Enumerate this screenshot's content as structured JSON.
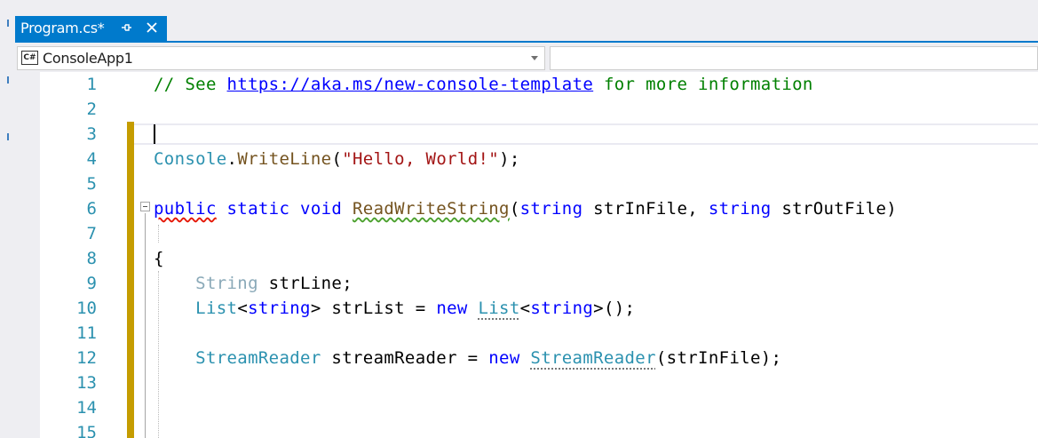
{
  "tab": {
    "title": "Program.cs*",
    "pin_icon": "pin-icon",
    "close_icon": "close-icon",
    "accent": "#007acc"
  },
  "navbar": {
    "project": "ConsoleApp1",
    "project_icon": "csharp-project-icon",
    "project_icon_text": "C#"
  },
  "editor": {
    "line_numbers": [
      "1",
      "2",
      "3",
      "4",
      "5",
      "6",
      "7",
      "8",
      "9",
      "10",
      "11",
      "12",
      "13",
      "14",
      "15"
    ],
    "lines": [
      [
        [
          "c",
          "// See "
        ],
        [
          "u",
          "https://aka.ms/new-console-template"
        ],
        [
          "c",
          " for more information"
        ]
      ],
      [],
      [],
      [
        [
          "t",
          "Console"
        ],
        [
          "",
          "."
        ],
        [
          "m",
          "WriteLine"
        ],
        [
          "",
          "("
        ],
        [
          "s",
          "\"Hello, World!\""
        ],
        [
          "",
          ");"
        ]
      ],
      [],
      [
        [
          "k wr",
          "public"
        ],
        [
          "",
          ""
        ],
        [
          "k",
          " static void "
        ],
        [
          "m wg",
          "ReadWriteString"
        ],
        [
          "",
          "("
        ],
        [
          "k",
          "string"
        ],
        [
          "",
          " strInFile, "
        ],
        [
          "k",
          "string"
        ],
        [
          "",
          " strOutFile)"
        ]
      ],
      [],
      [
        [
          "",
          "{"
        ]
      ],
      [
        [
          "g",
          "    String"
        ],
        [
          "",
          " strLine;"
        ]
      ],
      [
        [
          "t",
          "    List"
        ],
        [
          "",
          "<"
        ],
        [
          "k",
          "string"
        ],
        [
          "",
          "> strList = "
        ],
        [
          "k",
          "new "
        ],
        [
          "t dots",
          "List"
        ],
        [
          "",
          "<"
        ],
        [
          "k",
          "string"
        ],
        [
          "",
          ">();"
        ]
      ],
      [],
      [
        [
          "t",
          "    StreamReader"
        ],
        [
          "",
          " streamReader = "
        ],
        [
          "k",
          "new "
        ],
        [
          "t dots",
          "StreamReader"
        ],
        [
          "",
          "(strInFile);"
        ]
      ],
      [],
      [],
      []
    ],
    "current_line": 3,
    "change_color": "#c59c00"
  }
}
